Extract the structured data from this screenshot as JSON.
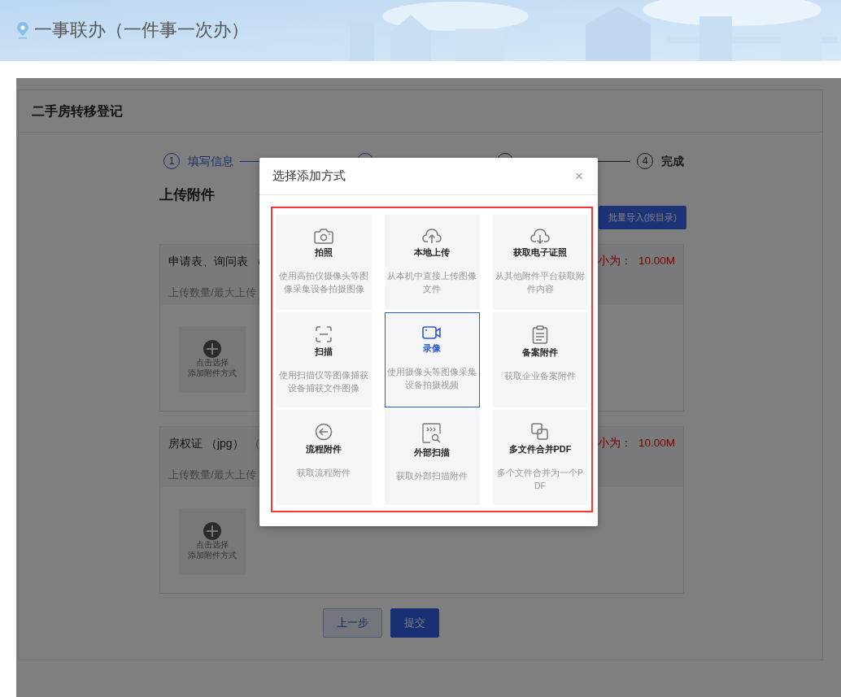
{
  "header": {
    "title": "一事联办（一件事一次办）"
  },
  "card": {
    "title": "二手房转移登记"
  },
  "steps": [
    {
      "number": "1",
      "label": "填写信息",
      "done": true
    },
    {
      "done": true
    },
    {
      "done": false
    },
    {
      "number": "4",
      "label": "完成",
      "done": false
    }
  ],
  "section_title": "上传附件",
  "batch_button": "批量导入(按目录)",
  "attachments": [
    {
      "title": "申请表、询问表 （",
      "size_label": "小为：",
      "size_value": "10.00M",
      "count_label": "上传数量/最大上传",
      "add_lines": [
        "点击选择",
        "添加附件方式"
      ]
    },
    {
      "title": "房权证 （jpg）",
      "note": "（",
      "size_label": "小为：",
      "size_value": "10.00M",
      "count_label": "上传数量/最大上传",
      "add_lines": [
        "点击选择",
        "添加附件方式"
      ]
    }
  ],
  "footer_buttons": [
    {
      "label": "上一步",
      "primary": false
    },
    {
      "label": "提交",
      "primary": true
    }
  ],
  "modal": {
    "title": "选择添加方式",
    "close": "×",
    "options": [
      {
        "title": "拍照",
        "desc": "使用高拍仪摄像头等图像采集设备拍摄图像",
        "selected": false
      },
      {
        "title": "本地上传",
        "desc": "从本机中直接上传图像文件",
        "selected": false
      },
      {
        "title": "获取电子证照",
        "desc": "从其他附件平台获取附件内容",
        "selected": false
      },
      {
        "title": "扫描",
        "desc": "使用扫描仪等图像捕获设备捕获文件图像",
        "selected": false
      },
      {
        "title": "录像",
        "desc": "使用摄像头等图像采集设备拍摄视频",
        "selected": true
      },
      {
        "title": "备案附件",
        "desc": "获取企业备案附件",
        "selected": false
      },
      {
        "title": "流程附件",
        "desc": "获取流程附件",
        "selected": false
      },
      {
        "title": "外部扫描",
        "desc": "获取外部扫描附件",
        "selected": false
      },
      {
        "title": "多文件合并PDF",
        "desc": "多个文件合并为一个PDF",
        "selected": false
      }
    ]
  }
}
